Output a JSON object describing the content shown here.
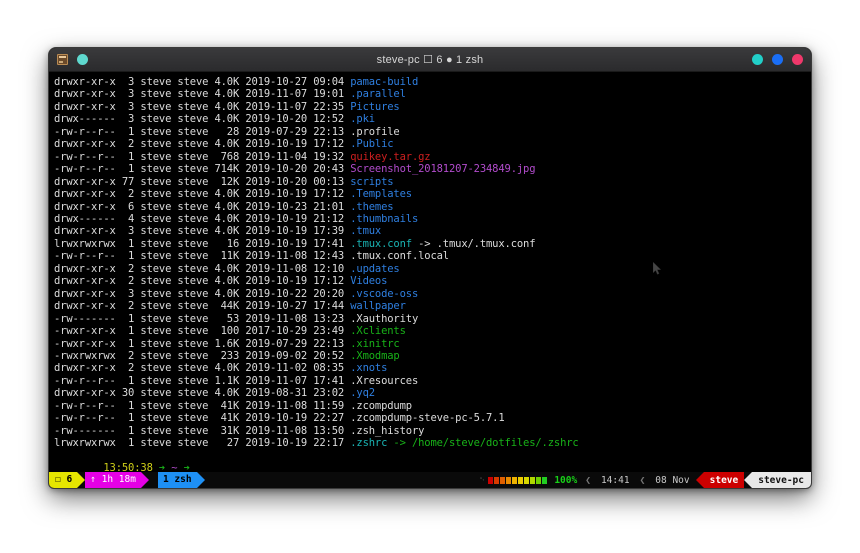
{
  "window": {
    "title": "steve-pc ☐ 6 ● 1 zsh",
    "left_icons": [
      {
        "name": "terminal-icon"
      },
      {
        "name": "status-dot-teal"
      }
    ],
    "right_buttons": [
      {
        "name": "window-button-cyan",
        "color": "#22cfc8"
      },
      {
        "name": "window-button-blue",
        "color": "#1a6ef5"
      },
      {
        "name": "window-button-pink",
        "color": "#f0386b"
      }
    ]
  },
  "terminal": {
    "rows": [
      {
        "perms": "drwxr-xr-x",
        "links": " 3",
        "user": "steve",
        "group": "steve",
        "size": "4.0K",
        "date": "2019-10-27",
        "time": "09:04",
        "name": "pamac-build",
        "color": "blue"
      },
      {
        "perms": "drwxr-xr-x",
        "links": " 3",
        "user": "steve",
        "group": "steve",
        "size": "4.0K",
        "date": "2019-11-07",
        "time": "19:01",
        "name": ".parallel",
        "color": "blue"
      },
      {
        "perms": "drwxr-xr-x",
        "links": " 3",
        "user": "steve",
        "group": "steve",
        "size": "4.0K",
        "date": "2019-11-07",
        "time": "22:35",
        "name": "Pictures",
        "color": "blue"
      },
      {
        "perms": "drwx------",
        "links": " 3",
        "user": "steve",
        "group": "steve",
        "size": "4.0K",
        "date": "2019-10-20",
        "time": "12:52",
        "name": ".pki",
        "color": "blue"
      },
      {
        "perms": "-rw-r--r--",
        "links": " 1",
        "user": "steve",
        "group": "steve",
        "size": "  28",
        "date": "2019-07-29",
        "time": "22:13",
        "name": ".profile",
        "color": "white"
      },
      {
        "perms": "drwxr-xr-x",
        "links": " 2",
        "user": "steve",
        "group": "steve",
        "size": "4.0K",
        "date": "2019-10-19",
        "time": "17:12",
        "name": ".Public",
        "color": "blue"
      },
      {
        "perms": "-rw-r--r--",
        "links": " 1",
        "user": "steve",
        "group": "steve",
        "size": " 768",
        "date": "2019-11-04",
        "time": "19:32",
        "name": "quikey.tar.gz",
        "color": "red"
      },
      {
        "perms": "-rw-r--r--",
        "links": " 1",
        "user": "steve",
        "group": "steve",
        "size": "714K",
        "date": "2019-10-20",
        "time": "20:43",
        "name": "Screenshot_20181207-234849.jpg",
        "color": "magenta"
      },
      {
        "perms": "drwxr-xr-x",
        "links": "77",
        "user": "steve",
        "group": "steve",
        "size": " 12K",
        "date": "2019-10-20",
        "time": "00:13",
        "name": "scripts",
        "color": "blue"
      },
      {
        "perms": "drwxr-xr-x",
        "links": " 2",
        "user": "steve",
        "group": "steve",
        "size": "4.0K",
        "date": "2019-10-19",
        "time": "17:12",
        "name": ".Templates",
        "color": "blue"
      },
      {
        "perms": "drwxr-xr-x",
        "links": " 6",
        "user": "steve",
        "group": "steve",
        "size": "4.0K",
        "date": "2019-10-23",
        "time": "21:01",
        "name": ".themes",
        "color": "blue"
      },
      {
        "perms": "drwx------",
        "links": " 4",
        "user": "steve",
        "group": "steve",
        "size": "4.0K",
        "date": "2019-10-19",
        "time": "21:12",
        "name": ".thumbnails",
        "color": "blue"
      },
      {
        "perms": "drwxr-xr-x",
        "links": " 3",
        "user": "steve",
        "group": "steve",
        "size": "4.0K",
        "date": "2019-10-19",
        "time": "17:39",
        "name": ".tmux",
        "color": "blue"
      },
      {
        "perms": "lrwxrwxrwx",
        "links": " 1",
        "user": "steve",
        "group": "steve",
        "size": "  16",
        "date": "2019-10-19",
        "time": "17:41",
        "name": ".tmux.conf",
        "color": "cyan",
        "link_target": " -> .tmux/.tmux.conf"
      },
      {
        "perms": "-rw-r--r--",
        "links": " 1",
        "user": "steve",
        "group": "steve",
        "size": " 11K",
        "date": "2019-11-08",
        "time": "12:43",
        "name": ".tmux.conf.local",
        "color": "white"
      },
      {
        "perms": "drwxr-xr-x",
        "links": " 2",
        "user": "steve",
        "group": "steve",
        "size": "4.0K",
        "date": "2019-11-08",
        "time": "12:10",
        "name": ".updates",
        "color": "blue"
      },
      {
        "perms": "drwxr-xr-x",
        "links": " 2",
        "user": "steve",
        "group": "steve",
        "size": "4.0K",
        "date": "2019-10-19",
        "time": "17:12",
        "name": "Videos",
        "color": "blue"
      },
      {
        "perms": "drwxr-xr-x",
        "links": " 3",
        "user": "steve",
        "group": "steve",
        "size": "4.0K",
        "date": "2019-10-22",
        "time": "20:20",
        "name": ".vscode-oss",
        "color": "blue"
      },
      {
        "perms": "drwxr-xr-x",
        "links": " 2",
        "user": "steve",
        "group": "steve",
        "size": " 44K",
        "date": "2019-10-27",
        "time": "17:44",
        "name": "wallpaper",
        "color": "blue"
      },
      {
        "perms": "-rw-------",
        "links": " 1",
        "user": "steve",
        "group": "steve",
        "size": "  53",
        "date": "2019-11-08",
        "time": "13:23",
        "name": ".Xauthority",
        "color": "white"
      },
      {
        "perms": "-rwxr-xr-x",
        "links": " 1",
        "user": "steve",
        "group": "steve",
        "size": " 100",
        "date": "2017-10-29",
        "time": "23:49",
        "name": ".Xclients",
        "color": "green"
      },
      {
        "perms": "-rwxr-xr-x",
        "links": " 1",
        "user": "steve",
        "group": "steve",
        "size": "1.6K",
        "date": "2019-07-29",
        "time": "22:13",
        "name": ".xinitrc",
        "color": "green"
      },
      {
        "perms": "-rwxrwxrwx",
        "links": " 2",
        "user": "steve",
        "group": "steve",
        "size": " 233",
        "date": "2019-09-02",
        "time": "20:52",
        "name": ".Xmodmap",
        "color": "green"
      },
      {
        "perms": "drwxr-xr-x",
        "links": " 2",
        "user": "steve",
        "group": "steve",
        "size": "4.0K",
        "date": "2019-11-02",
        "time": "08:35",
        "name": ".xnots",
        "color": "blue"
      },
      {
        "perms": "-rw-r--r--",
        "links": " 1",
        "user": "steve",
        "group": "steve",
        "size": "1.1K",
        "date": "2019-11-07",
        "time": "17:41",
        "name": ".Xresources",
        "color": "white"
      },
      {
        "perms": "drwxr-xr-x",
        "links": "30",
        "user": "steve",
        "group": "steve",
        "size": "4.0K",
        "date": "2019-08-31",
        "time": "23:02",
        "name": ".yq2",
        "color": "blue"
      },
      {
        "perms": "-rw-r--r--",
        "links": " 1",
        "user": "steve",
        "group": "steve",
        "size": " 41K",
        "date": "2019-11-08",
        "time": "11:59",
        "name": ".zcompdump",
        "color": "white"
      },
      {
        "perms": "-rw-r--r--",
        "links": " 1",
        "user": "steve",
        "group": "steve",
        "size": " 41K",
        "date": "2019-10-19",
        "time": "22:27",
        "name": ".zcompdump-steve-pc-5.7.1",
        "color": "white"
      },
      {
        "perms": "-rw-------",
        "links": " 1",
        "user": "steve",
        "group": "steve",
        "size": " 31K",
        "date": "2019-11-08",
        "time": "13:50",
        "name": ".zsh_history",
        "color": "white"
      },
      {
        "perms": "lrwxrwxrwx",
        "links": " 1",
        "user": "steve",
        "group": "steve",
        "size": "  27",
        "date": "2019-10-19",
        "time": "22:17",
        "name": ".zshrc",
        "color": "cyan",
        "link_target": " -> /home/steve/dotfiles/.zshrc",
        "target_color": "green"
      }
    ],
    "prompt": {
      "time": "13:50:38",
      "arrow1": "➔",
      "path": "~",
      "arrow2": "➔",
      "cursor": ""
    }
  },
  "statusbar": {
    "session_label": "☐ 6",
    "uptime_label": "↑ 1h 18m",
    "window_label": "1 zsh",
    "battery_icon": "␉",
    "battery_blocks": [
      "#cc0000",
      "#d83a00",
      "#e06000",
      "#e88a00",
      "#efb300",
      "#eccd00",
      "#d8d800",
      "#b0d800",
      "#6ed000",
      "#22cc22"
    ],
    "battery_pct": "100%",
    "clock": "14:41",
    "date": "08 Nov",
    "user": "steve",
    "host": "steve-pc",
    "chevron": "❮"
  }
}
